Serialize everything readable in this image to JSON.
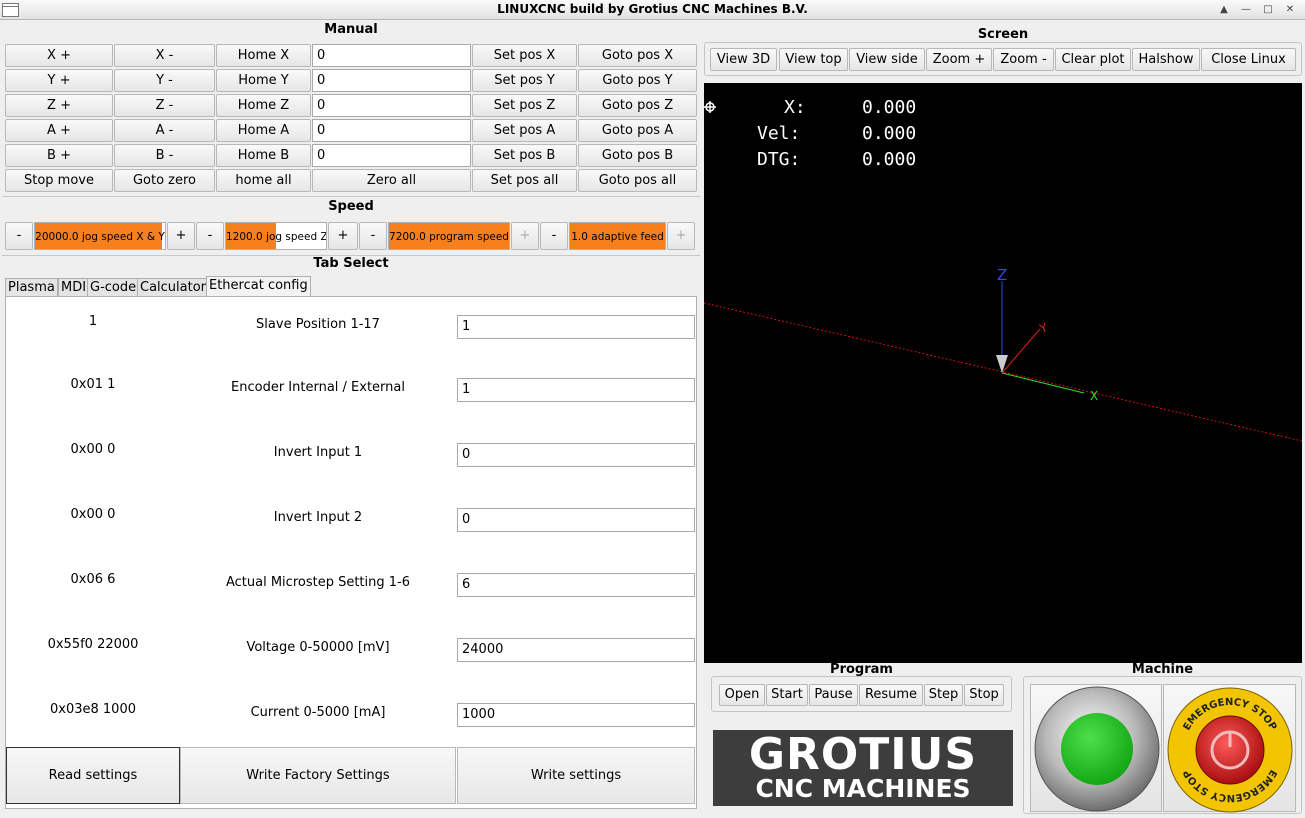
{
  "window": {
    "title": "LINUXCNC build by Grotius CNC Machines B.V."
  },
  "manual": {
    "title": "Manual",
    "rows": [
      {
        "plus": "X +",
        "minus": "X -",
        "home": "Home X",
        "value": "0",
        "setpos": "Set pos X",
        "goto": "Goto pos X"
      },
      {
        "plus": "Y +",
        "minus": "Y -",
        "home": "Home Y",
        "value": "0",
        "setpos": "Set pos Y",
        "goto": "Goto pos Y"
      },
      {
        "plus": "Z +",
        "minus": "Z -",
        "home": "Home Z",
        "value": "0",
        "setpos": "Set pos Z",
        "goto": "Goto pos Z"
      },
      {
        "plus": "A +",
        "minus": "A -",
        "home": "Home A",
        "value": "0",
        "setpos": "Set pos A",
        "goto": "Goto pos A"
      },
      {
        "plus": "B +",
        "minus": "B -",
        "home": "Home B",
        "value": "0",
        "setpos": "Set pos B",
        "goto": "Goto pos B"
      }
    ],
    "bottom": {
      "stop": "Stop move",
      "goto_zero": "Goto zero",
      "home_all": "home all",
      "zero_all": "Zero all",
      "setpos_all": "Set pos all",
      "goto_all": "Goto pos all"
    }
  },
  "speed": {
    "title": "Speed",
    "minus": "-",
    "plus": "+",
    "jog_xy": {
      "label": "20000.0 jog speed X & Y",
      "level": 0.98
    },
    "jog_z": {
      "label": "1200.0 jog speed Z",
      "level": 0.5
    },
    "program": {
      "label": "7200.0 program speed",
      "level": 1.0
    },
    "adaptive": {
      "label": "1.0 adaptive feed",
      "level": 1.0
    }
  },
  "tabs": {
    "title": "Tab Select",
    "items": [
      "Plasma",
      "MDI",
      "G-code",
      "Calculator",
      "Ethercat config"
    ],
    "active": "Ethercat config"
  },
  "ethercat": {
    "rows": [
      {
        "hex": "1",
        "label": "Slave Position  1-17",
        "value": "1"
      },
      {
        "hex": "0x01 1",
        "label": "Encoder Internal / External",
        "value": "1"
      },
      {
        "hex": "0x00 0",
        "label": "Invert Input 1",
        "value": "0"
      },
      {
        "hex": "0x00 0",
        "label": "Invert Input 2",
        "value": "0"
      },
      {
        "hex": "0x06 6",
        "label": "Actual Microstep Setting  1-6",
        "value": "6"
      },
      {
        "hex": "0x55f0 22000",
        "label": "Voltage 0-50000 [mV]",
        "value": "24000"
      },
      {
        "hex": "0x03e8 1000",
        "label": "Current  0-5000 [mA]",
        "value": "1000"
      }
    ],
    "buttons": {
      "read": "Read settings",
      "write_factory": "Write Factory Settings",
      "write": "Write settings"
    }
  },
  "screen": {
    "title": "Screen",
    "buttons": [
      "View 3D",
      "View top",
      "View side",
      "Zoom +",
      "Zoom -",
      "Clear plot",
      "Halshow",
      "Close Linux"
    ],
    "dro": [
      {
        "label": "X:",
        "value": "0.000"
      },
      {
        "label": "Vel:",
        "value": "0.000"
      },
      {
        "label": "DTG:",
        "value": "0.000"
      }
    ],
    "axes": {
      "x": "X",
      "y": "Y",
      "z": "Z"
    }
  },
  "program": {
    "title": "Program",
    "buttons": [
      "Open",
      "Start",
      "Pause",
      "Resume",
      "Step",
      "Stop"
    ]
  },
  "logo": {
    "line1": "GROTIUS",
    "line2": "CNC MACHINES"
  },
  "machine": {
    "title": "Machine",
    "estop_text": "EMERGENCY STOP"
  },
  "colors": {
    "accent": "#f7801e",
    "screen_bg": "#000000",
    "start_green": "#1fc11f",
    "estop_red": "#d41c1c",
    "estop_yellow": "#f3c500"
  }
}
